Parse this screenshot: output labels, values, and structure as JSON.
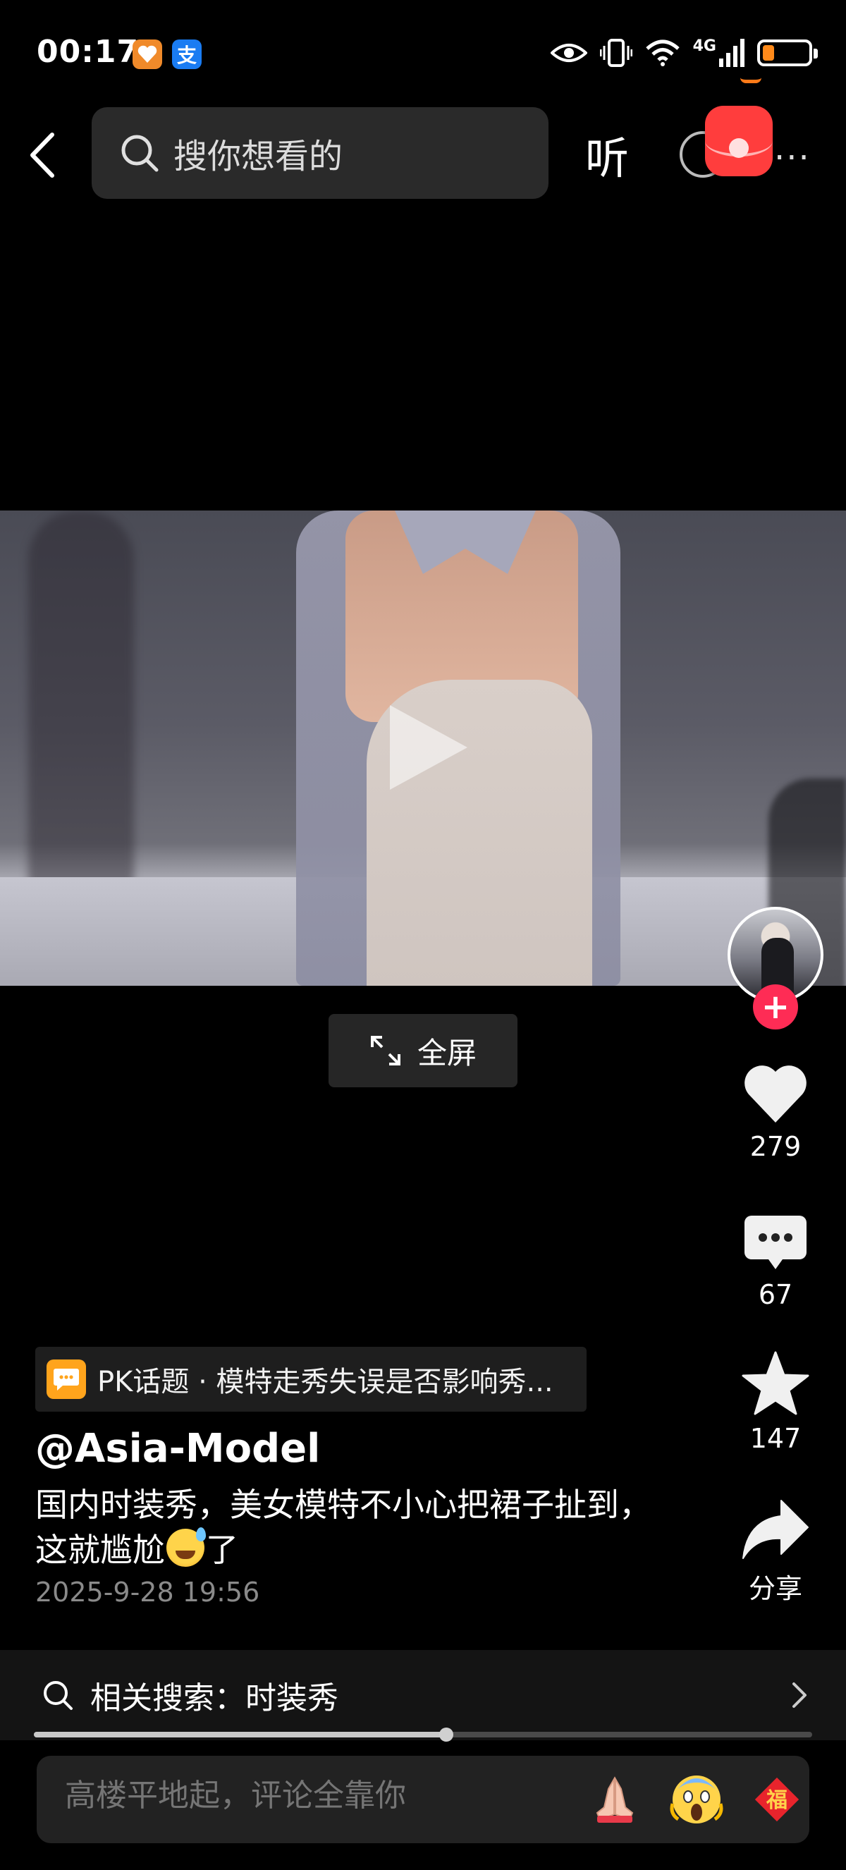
{
  "status_bar": {
    "time": "00:17",
    "app_badges": [
      {
        "name": "heart-app-icon",
        "glyph": "♥",
        "color": "#f08a2a"
      },
      {
        "name": "alipay-icon",
        "glyph": "支",
        "color": "#1a7cf2"
      }
    ],
    "network_label": "4G",
    "battery_level": 0.25,
    "battery_color": "#ff8a1a"
  },
  "top_bar": {
    "search_placeholder": "搜你想看的",
    "listen_label": "听"
  },
  "video": {
    "fullscreen_label": "全屏"
  },
  "right_rail": {
    "follow_symbol": "+",
    "likes_count": "279",
    "comments_count": "67",
    "favorites_count": "147",
    "share_label": "分享"
  },
  "caption": {
    "topic_text": "PK话题 · 模特走秀失误是否影响秀...",
    "author_name": "@Asia-Model",
    "text_line1": "国内时装秀，美女模特不小心把裙子扯到，",
    "text_line2_before": "这就尴尬",
    "text_line2_after": "了",
    "date": "2025-9-28 19:56"
  },
  "related_search": {
    "label": "相关搜索：时装秀"
  },
  "progress": {
    "fraction": 0.53
  },
  "comment_bar": {
    "placeholder": "高楼平地起，评论全靠你",
    "quick_emojis": [
      "pray-emoji-icon",
      "scream-emoji-icon",
      "fu-emoji-icon"
    ],
    "fu_glyph": "福"
  },
  "colors": {
    "accent_red": "#fe2c55",
    "topic_orange": "#ffa41c"
  }
}
